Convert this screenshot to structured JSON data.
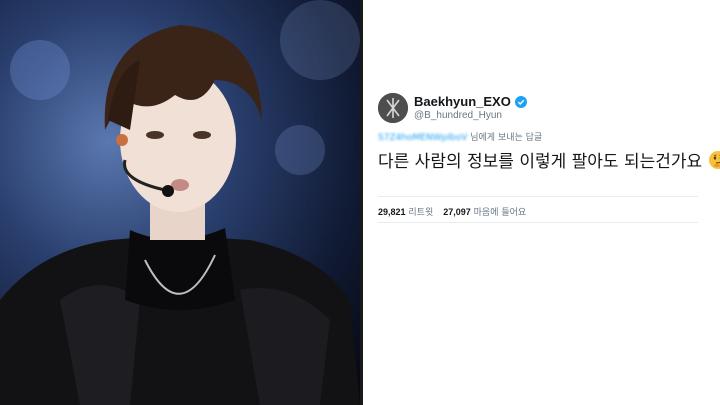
{
  "profile": {
    "display_name": "Baekhyun_EXO",
    "handle": "@B_hundred_Hyun"
  },
  "reply": {
    "to_blurred": "S7Z4hoMENWpIboV",
    "label": "님에게 보내는 답글"
  },
  "tweet": {
    "text": "다른 사람의 정보를 이렇게 팔아도 되는건가요"
  },
  "stats": {
    "retweet_count": "29,821",
    "retweet_label": "리트윗",
    "like_count": "27,097",
    "like_label": "마음에 들어요"
  },
  "icons": {
    "verified": "verified-badge-icon",
    "emoji": "thinking-face-emoji"
  },
  "colors": {
    "verified_blue": "#1da1f2",
    "text_dark": "#14171a",
    "text_muted": "#657786"
  }
}
